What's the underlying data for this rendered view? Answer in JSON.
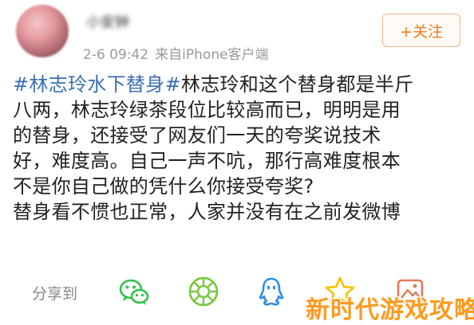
{
  "post": {
    "username": "小安钟",
    "timestamp": "2-6 09:42",
    "source": "来自iPhone客户端",
    "follow_label": "+关注",
    "content_lines": [
      {
        "hashtag": "#林志玲水下替身#",
        "text": "林志玲和这个替身都是半斤"
      },
      {
        "hashtag": "",
        "text": "八两，林志玲绿茶段位比较高而已，明明是用"
      },
      {
        "hashtag": "",
        "text": "的替身，还接受了网友们一天的夸奖说技术"
      },
      {
        "hashtag": "",
        "text": "好，难度高。自己一声不吭，那行高难度根本"
      },
      {
        "hashtag": "",
        "text": "不是你自己做的凭什么你接受夸奖?"
      },
      {
        "hashtag": "",
        "text": "替身看不惯也正常，人家并没有在之前发微博"
      }
    ]
  },
  "share": {
    "label": "分享到",
    "icons": [
      "wechat-icon",
      "moments-icon",
      "qq-icon",
      "qzone-icon",
      "photo-icon"
    ]
  },
  "watermark": "新时代游戏攻略",
  "colors": {
    "hashtag": "#3b6fb6",
    "follow_orange": "#f07b1c",
    "watermark_orange": "#ff9a1f",
    "wechat_green": "#2ec24b",
    "moments_green": "#7ac943",
    "qq_blue": "#2d8cf0",
    "qzone_yellow": "#f6c40a"
  }
}
